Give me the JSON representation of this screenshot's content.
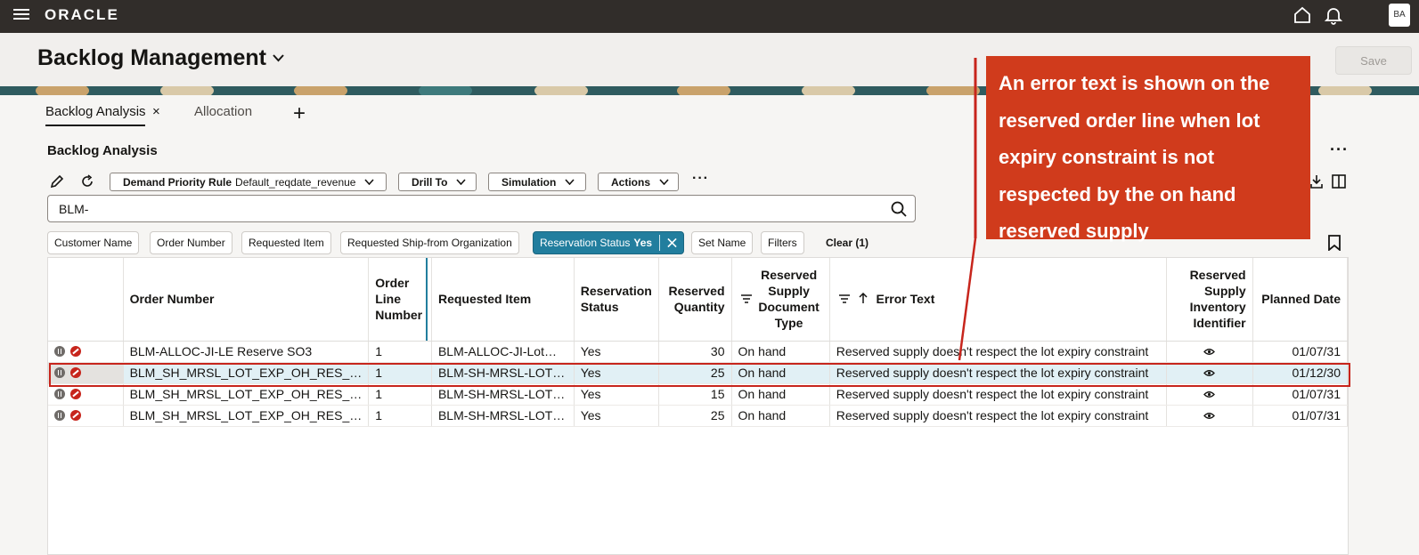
{
  "app": {
    "logo": "ORACLE",
    "user_initials": "BA"
  },
  "header": {
    "title": "Backlog Management",
    "save_label": "Save"
  },
  "tabs": [
    {
      "label": "Backlog Analysis",
      "close": "×"
    },
    {
      "label": "Allocation"
    }
  ],
  "tab_add": "+",
  "section": {
    "title": "Backlog Analysis",
    "more": "···"
  },
  "toolbar": {
    "demand_priority_label": "Demand Priority Rule",
    "demand_priority_value": "Default_reqdate_revenue",
    "drill_to": "Drill To",
    "simulation": "Simulation",
    "actions": "Actions",
    "more": "···"
  },
  "search": {
    "value": "BLM-"
  },
  "filters": {
    "chips": [
      "Customer Name",
      "Order Number",
      "Requested Item",
      "Requested Ship-from Organization"
    ],
    "active_label": "Reservation Status",
    "active_value": "Yes",
    "set_name": "Set Name",
    "filters": "Filters",
    "clear": "Clear (1)"
  },
  "table": {
    "headers": {
      "order_number": "Order Number",
      "order_line": "Order Line Number",
      "requested_item": "Requested Item",
      "reservation_status": "Reservation Status",
      "reserved_qty": "Reserved Quantity",
      "supply_doc_type": "Reserved Supply Document Type",
      "error_text": "Error Text",
      "inventory_id": "Reserved Supply Inventory Identifier",
      "planned_date": "Planned Date"
    },
    "rows": [
      {
        "order_number": "BLM-ALLOC-JI-LE Reserve SO3",
        "line": "1",
        "item": "BLM-ALLOC-JI-Lot…",
        "status": "Yes",
        "qty": "30",
        "doc_type": "On hand",
        "error": "Reserved supply doesn't respect the lot expiry constraint",
        "planned": "01/07/31"
      },
      {
        "order_number": "BLM_SH_MRSL_LOT_EXP_OH_RES_…",
        "line": "1",
        "item": "BLM-SH-MRSL-LOT…",
        "status": "Yes",
        "qty": "25",
        "doc_type": "On hand",
        "error": "Reserved supply doesn't respect the lot expiry constraint",
        "planned": "01/12/30"
      },
      {
        "order_number": "BLM_SH_MRSL_LOT_EXP_OH_RES_…",
        "line": "1",
        "item": "BLM-SH-MRSL-LOT…",
        "status": "Yes",
        "qty": "15",
        "doc_type": "On hand",
        "error": "Reserved supply doesn't respect the lot expiry constraint",
        "planned": "01/07/31"
      },
      {
        "order_number": "BLM_SH_MRSL_LOT_EXP_OH_RES_…",
        "line": "1",
        "item": "BLM-SH-MRSL-LOT…",
        "status": "Yes",
        "qty": "25",
        "doc_type": "On hand",
        "error": "Reserved supply doesn't respect the lot expiry constraint",
        "planned": "01/07/31"
      }
    ]
  },
  "callout": {
    "text": "An error text is shown on the reserved order line when lot expiry constraint is not respected by the on hand reserved supply"
  },
  "colors": {
    "topbar": "#312d2a",
    "accent": "#227e9e",
    "callout": "#d03b1c",
    "highlight": "#c7251c"
  }
}
